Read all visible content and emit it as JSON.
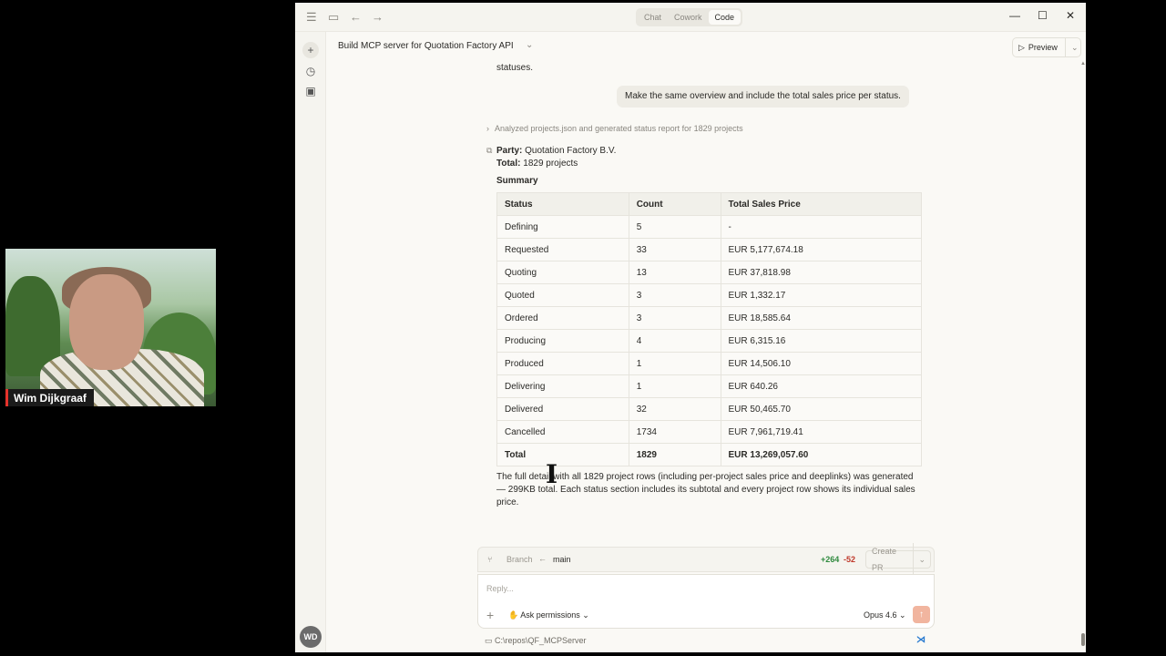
{
  "webcam": {
    "participant_name": "Wim Dijkgraaf"
  },
  "titlebar": {
    "modes": [
      "Chat",
      "Cowork",
      "Code"
    ],
    "active_mode": "Code"
  },
  "header": {
    "title": "Build MCP server for Quotation Factory API",
    "preview_label": "Preview"
  },
  "sidebar": {
    "avatar_initials": "WD"
  },
  "conversation": {
    "previous_tail": "statuses.",
    "user_message": "Make the same overview and include the total sales price per status.",
    "tool_summary": "Analyzed projects.json and generated status report for 1829 projects",
    "party_label": "Party:",
    "party_value": "Quotation Factory B.V.",
    "total_label": "Total:",
    "total_value": "1829 projects",
    "summary_heading": "Summary",
    "table": {
      "headers": [
        "Status",
        "Count",
        "Total Sales Price"
      ],
      "rows": [
        [
          "Defining",
          "5",
          "-"
        ],
        [
          "Requested",
          "33",
          "EUR 5,177,674.18"
        ],
        [
          "Quoting",
          "13",
          "EUR 37,818.98"
        ],
        [
          "Quoted",
          "3",
          "EUR 1,332.17"
        ],
        [
          "Ordered",
          "3",
          "EUR 18,585.64"
        ],
        [
          "Producing",
          "4",
          "EUR 6,315.16"
        ],
        [
          "Produced",
          "1",
          "EUR 14,506.10"
        ],
        [
          "Delivering",
          "1",
          "EUR 640.26"
        ],
        [
          "Delivered",
          "32",
          "EUR 50,465.70"
        ],
        [
          "Cancelled",
          "1734",
          "EUR 7,961,719.41"
        ]
      ],
      "total_row": [
        "Total",
        "1829",
        "EUR 13,269,057.60"
      ]
    },
    "detail_text": "The full detail with all 1829 project rows (including per-project sales price and deeplinks) was generated — 299KB total. Each status section includes its subtotal and every project row shows its individual sales price."
  },
  "composer": {
    "branch_label": "Branch",
    "branch_name": "main",
    "additions": "+264",
    "deletions": "-52",
    "create_pr_label": "Create PR",
    "reply_placeholder": "Reply...",
    "ask_permissions_label": "Ask permissions",
    "model_label": "Opus 4.6",
    "repo_path": "C:\\repos\\QF_MCPServer"
  }
}
